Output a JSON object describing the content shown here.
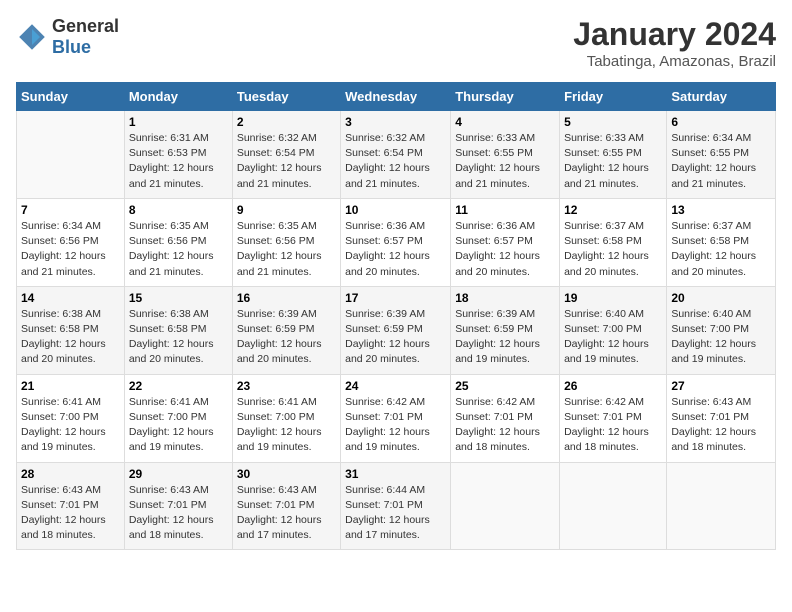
{
  "header": {
    "logo_general": "General",
    "logo_blue": "Blue",
    "title": "January 2024",
    "subtitle": "Tabatinga, Amazonas, Brazil"
  },
  "columns": [
    "Sunday",
    "Monday",
    "Tuesday",
    "Wednesday",
    "Thursday",
    "Friday",
    "Saturday"
  ],
  "weeks": [
    [
      {
        "day": "",
        "info": ""
      },
      {
        "day": "1",
        "info": "Sunrise: 6:31 AM\nSunset: 6:53 PM\nDaylight: 12 hours\nand 21 minutes."
      },
      {
        "day": "2",
        "info": "Sunrise: 6:32 AM\nSunset: 6:54 PM\nDaylight: 12 hours\nand 21 minutes."
      },
      {
        "day": "3",
        "info": "Sunrise: 6:32 AM\nSunset: 6:54 PM\nDaylight: 12 hours\nand 21 minutes."
      },
      {
        "day": "4",
        "info": "Sunrise: 6:33 AM\nSunset: 6:55 PM\nDaylight: 12 hours\nand 21 minutes."
      },
      {
        "day": "5",
        "info": "Sunrise: 6:33 AM\nSunset: 6:55 PM\nDaylight: 12 hours\nand 21 minutes."
      },
      {
        "day": "6",
        "info": "Sunrise: 6:34 AM\nSunset: 6:55 PM\nDaylight: 12 hours\nand 21 minutes."
      }
    ],
    [
      {
        "day": "7",
        "info": "Sunrise: 6:34 AM\nSunset: 6:56 PM\nDaylight: 12 hours\nand 21 minutes."
      },
      {
        "day": "8",
        "info": "Sunrise: 6:35 AM\nSunset: 6:56 PM\nDaylight: 12 hours\nand 21 minutes."
      },
      {
        "day": "9",
        "info": "Sunrise: 6:35 AM\nSunset: 6:56 PM\nDaylight: 12 hours\nand 21 minutes."
      },
      {
        "day": "10",
        "info": "Sunrise: 6:36 AM\nSunset: 6:57 PM\nDaylight: 12 hours\nand 20 minutes."
      },
      {
        "day": "11",
        "info": "Sunrise: 6:36 AM\nSunset: 6:57 PM\nDaylight: 12 hours\nand 20 minutes."
      },
      {
        "day": "12",
        "info": "Sunrise: 6:37 AM\nSunset: 6:58 PM\nDaylight: 12 hours\nand 20 minutes."
      },
      {
        "day": "13",
        "info": "Sunrise: 6:37 AM\nSunset: 6:58 PM\nDaylight: 12 hours\nand 20 minutes."
      }
    ],
    [
      {
        "day": "14",
        "info": "Sunrise: 6:38 AM\nSunset: 6:58 PM\nDaylight: 12 hours\nand 20 minutes."
      },
      {
        "day": "15",
        "info": "Sunrise: 6:38 AM\nSunset: 6:58 PM\nDaylight: 12 hours\nand 20 minutes."
      },
      {
        "day": "16",
        "info": "Sunrise: 6:39 AM\nSunset: 6:59 PM\nDaylight: 12 hours\nand 20 minutes."
      },
      {
        "day": "17",
        "info": "Sunrise: 6:39 AM\nSunset: 6:59 PM\nDaylight: 12 hours\nand 20 minutes."
      },
      {
        "day": "18",
        "info": "Sunrise: 6:39 AM\nSunset: 6:59 PM\nDaylight: 12 hours\nand 19 minutes."
      },
      {
        "day": "19",
        "info": "Sunrise: 6:40 AM\nSunset: 7:00 PM\nDaylight: 12 hours\nand 19 minutes."
      },
      {
        "day": "20",
        "info": "Sunrise: 6:40 AM\nSunset: 7:00 PM\nDaylight: 12 hours\nand 19 minutes."
      }
    ],
    [
      {
        "day": "21",
        "info": "Sunrise: 6:41 AM\nSunset: 7:00 PM\nDaylight: 12 hours\nand 19 minutes."
      },
      {
        "day": "22",
        "info": "Sunrise: 6:41 AM\nSunset: 7:00 PM\nDaylight: 12 hours\nand 19 minutes."
      },
      {
        "day": "23",
        "info": "Sunrise: 6:41 AM\nSunset: 7:00 PM\nDaylight: 12 hours\nand 19 minutes."
      },
      {
        "day": "24",
        "info": "Sunrise: 6:42 AM\nSunset: 7:01 PM\nDaylight: 12 hours\nand 19 minutes."
      },
      {
        "day": "25",
        "info": "Sunrise: 6:42 AM\nSunset: 7:01 PM\nDaylight: 12 hours\nand 18 minutes."
      },
      {
        "day": "26",
        "info": "Sunrise: 6:42 AM\nSunset: 7:01 PM\nDaylight: 12 hours\nand 18 minutes."
      },
      {
        "day": "27",
        "info": "Sunrise: 6:43 AM\nSunset: 7:01 PM\nDaylight: 12 hours\nand 18 minutes."
      }
    ],
    [
      {
        "day": "28",
        "info": "Sunrise: 6:43 AM\nSunset: 7:01 PM\nDaylight: 12 hours\nand 18 minutes."
      },
      {
        "day": "29",
        "info": "Sunrise: 6:43 AM\nSunset: 7:01 PM\nDaylight: 12 hours\nand 18 minutes."
      },
      {
        "day": "30",
        "info": "Sunrise: 6:43 AM\nSunset: 7:01 PM\nDaylight: 12 hours\nand 17 minutes."
      },
      {
        "day": "31",
        "info": "Sunrise: 6:44 AM\nSunset: 7:01 PM\nDaylight: 12 hours\nand 17 minutes."
      },
      {
        "day": "",
        "info": ""
      },
      {
        "day": "",
        "info": ""
      },
      {
        "day": "",
        "info": ""
      }
    ]
  ]
}
